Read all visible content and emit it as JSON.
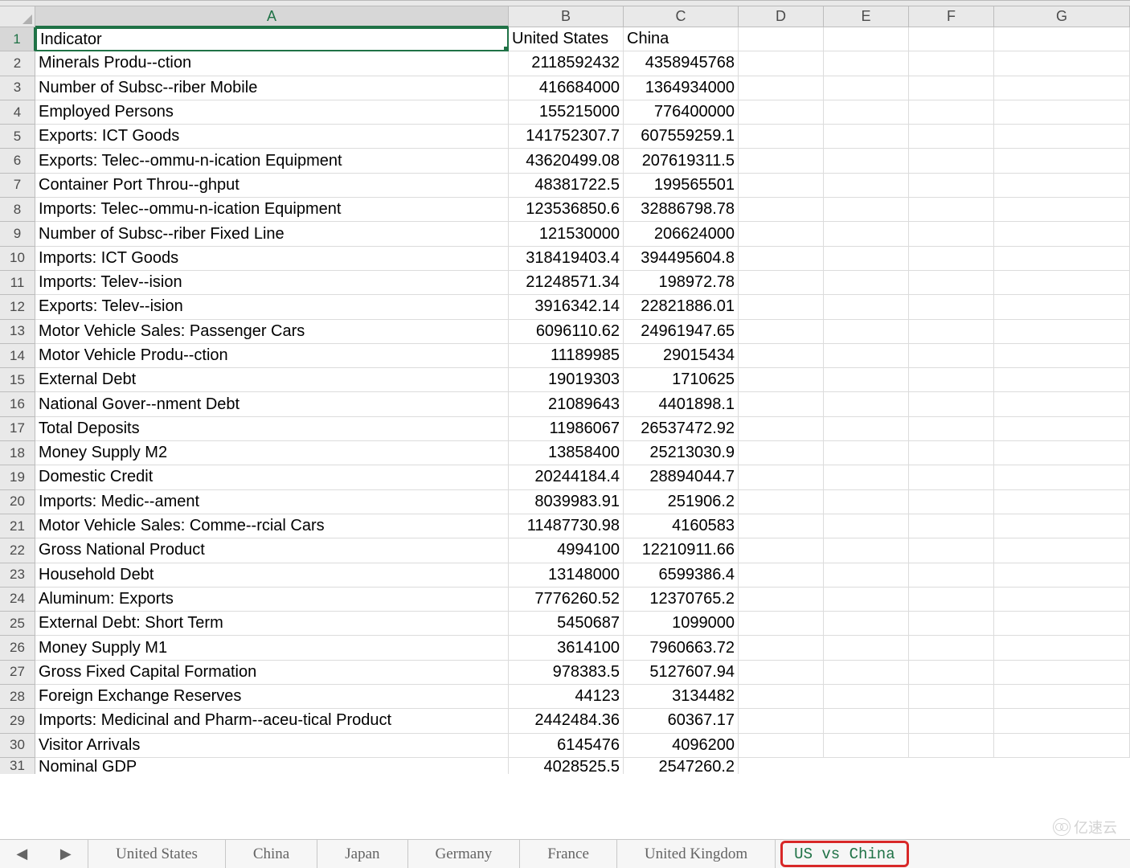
{
  "columns": [
    "A",
    "B",
    "C",
    "D",
    "E",
    "F",
    "G"
  ],
  "active_cell": "A1",
  "rows": [
    {
      "n": 1,
      "a": "Indicator",
      "b": "United States",
      "c": "China"
    },
    {
      "n": 2,
      "a": "Minerals Produ--ction",
      "b": "2118592432",
      "c": "4358945768"
    },
    {
      "n": 3,
      "a": "Number of Subsc--riber Mobile",
      "b": "416684000",
      "c": "1364934000"
    },
    {
      "n": 4,
      "a": "Employed Persons",
      "b": "155215000",
      "c": "776400000"
    },
    {
      "n": 5,
      "a": "Exports: ICT Goods",
      "b": "141752307.7",
      "c": "607559259.1"
    },
    {
      "n": 6,
      "a": "Exports: Telec--ommu-n-ication Equipment",
      "b": "43620499.08",
      "c": "207619311.5"
    },
    {
      "n": 7,
      "a": "Container Port Throu--ghput",
      "b": "48381722.5",
      "c": "199565501"
    },
    {
      "n": 8,
      "a": "Imports: Telec--ommu-n-ication Equipment",
      "b": "123536850.6",
      "c": "32886798.78"
    },
    {
      "n": 9,
      "a": "Number of Subsc--riber Fixed Line",
      "b": "121530000",
      "c": "206624000"
    },
    {
      "n": 10,
      "a": "Imports: ICT Goods",
      "b": "318419403.4",
      "c": "394495604.8"
    },
    {
      "n": 11,
      "a": "Imports: Telev--ision",
      "b": "21248571.34",
      "c": "198972.78"
    },
    {
      "n": 12,
      "a": "Exports: Telev--ision",
      "b": "3916342.14",
      "c": "22821886.01"
    },
    {
      "n": 13,
      "a": "Motor Vehicle Sales: Passenger Cars",
      "b": "6096110.62",
      "c": "24961947.65"
    },
    {
      "n": 14,
      "a": "Motor Vehicle Produ--ction",
      "b": "11189985",
      "c": "29015434"
    },
    {
      "n": 15,
      "a": "External Debt",
      "b": "19019303",
      "c": "1710625"
    },
    {
      "n": 16,
      "a": "National Gover--nment Debt",
      "b": "21089643",
      "c": "4401898.1"
    },
    {
      "n": 17,
      "a": "Total Deposits",
      "b": "11986067",
      "c": "26537472.92"
    },
    {
      "n": 18,
      "a": "Money Supply M2",
      "b": "13858400",
      "c": "25213030.9"
    },
    {
      "n": 19,
      "a": "Domestic Credit",
      "b": "20244184.4",
      "c": "28894044.7"
    },
    {
      "n": 20,
      "a": "Imports: Medic--ament",
      "b": "8039983.91",
      "c": "251906.2"
    },
    {
      "n": 21,
      "a": "Motor Vehicle Sales: Comme--rcial Cars",
      "b": "11487730.98",
      "c": "4160583"
    },
    {
      "n": 22,
      "a": "Gross National Product",
      "b": "4994100",
      "c": "12210911.66"
    },
    {
      "n": 23,
      "a": "Household Debt",
      "b": "13148000",
      "c": "6599386.4"
    },
    {
      "n": 24,
      "a": "Aluminum: Exports",
      "b": "7776260.52",
      "c": "12370765.2"
    },
    {
      "n": 25,
      "a": "External Debt: Short Term",
      "b": "5450687",
      "c": "1099000"
    },
    {
      "n": 26,
      "a": "Money Supply M1",
      "b": "3614100",
      "c": "7960663.72"
    },
    {
      "n": 27,
      "a": "Gross Fixed Capital Formation",
      "b": "978383.5",
      "c": "5127607.94"
    },
    {
      "n": 28,
      "a": "Foreign Exchange Reserves",
      "b": "44123",
      "c": "3134482"
    },
    {
      "n": 29,
      "a": "Imports: Medicinal and Pharm--aceu-tical Product",
      "b": "2442484.36",
      "c": "60367.17"
    },
    {
      "n": 30,
      "a": "Visitor Arrivals",
      "b": "6145476",
      "c": "4096200"
    },
    {
      "n": 31,
      "a": "Nominal GDP",
      "b": "4028525.5",
      "c": "2547260.2"
    }
  ],
  "tabs": {
    "items": [
      {
        "label": "United States",
        "active": false
      },
      {
        "label": "China",
        "active": false
      },
      {
        "label": "Japan",
        "active": false
      },
      {
        "label": "Germany",
        "active": false
      },
      {
        "label": "France",
        "active": false
      },
      {
        "label": "United Kingdom",
        "active": false
      },
      {
        "label": "US vs China",
        "active": true
      }
    ]
  },
  "watermark": "亿速云"
}
